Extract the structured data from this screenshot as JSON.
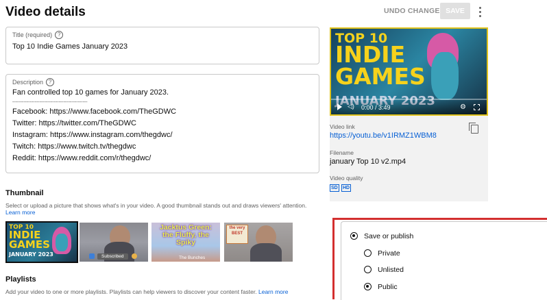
{
  "header": {
    "title": "Video details",
    "undo_label": "UNDO CHANGES",
    "save_label": "SAVE"
  },
  "title_field": {
    "label": "Title (required)",
    "value": "Top 10 Indie Games January 2023"
  },
  "description_field": {
    "label": "Description",
    "lines": [
      "Fan controlled top 10 games for January 2023.",
      "-----------------------------------------------",
      "Facebook: https://www.facebook.com/TheGDWC",
      "Twitter: https://twitter.com/TheGDWC",
      "Instagram: https://www.instagram.com/thegdwc/",
      "Twitch: https://www.twitch.tv/thegdwc",
      "Reddit: https://www.reddit.com/r/thegdwc/"
    ]
  },
  "thumbnail": {
    "heading": "Thumbnail",
    "desc": "Select or upload a picture that shows what's in your video. A good thumbnail stands out and draws viewers' attention.",
    "learn_more": "Learn more",
    "thumb1": {
      "line1": "TOP 10",
      "line2": "INDIE",
      "line3": "GAMES",
      "line4": "JANUARY 2023"
    },
    "thumb2": {
      "badge": "Subscribed"
    },
    "thumb3": {
      "text": "Jacktus Green: the Fluffy, the Spiky",
      "caption": "The Bunches"
    },
    "thumb4": {
      "text": "the very BEST"
    }
  },
  "playlists": {
    "heading": "Playlists",
    "desc": "Add your video to one or more playlists. Playlists can help viewers to discover your content faster.",
    "learn_more": "Learn more"
  },
  "video_panel": {
    "preview": {
      "line1": "TOP 10",
      "line2": "INDIE",
      "line3": "GAMES",
      "line4": "JANUARY 2023",
      "time": "0:00 / 3:49"
    },
    "link_label": "Video link",
    "link_value": "https://youtu.be/v1IRMZ1WBM8",
    "filename_label": "Filename",
    "filename_value": "january Top 10 v2.mp4",
    "quality_label": "Video quality",
    "quality_badges": [
      "SD",
      "HD"
    ]
  },
  "visibility": {
    "main_label": "Save or publish",
    "options": [
      {
        "label": "Private",
        "selected": false
      },
      {
        "label": "Unlisted",
        "selected": false
      },
      {
        "label": "Public",
        "selected": true
      }
    ]
  },
  "colors": {
    "accent_link": "#065fd4",
    "highlight_border": "#d32f2f",
    "thumb_yellow": "#f6d21c"
  }
}
